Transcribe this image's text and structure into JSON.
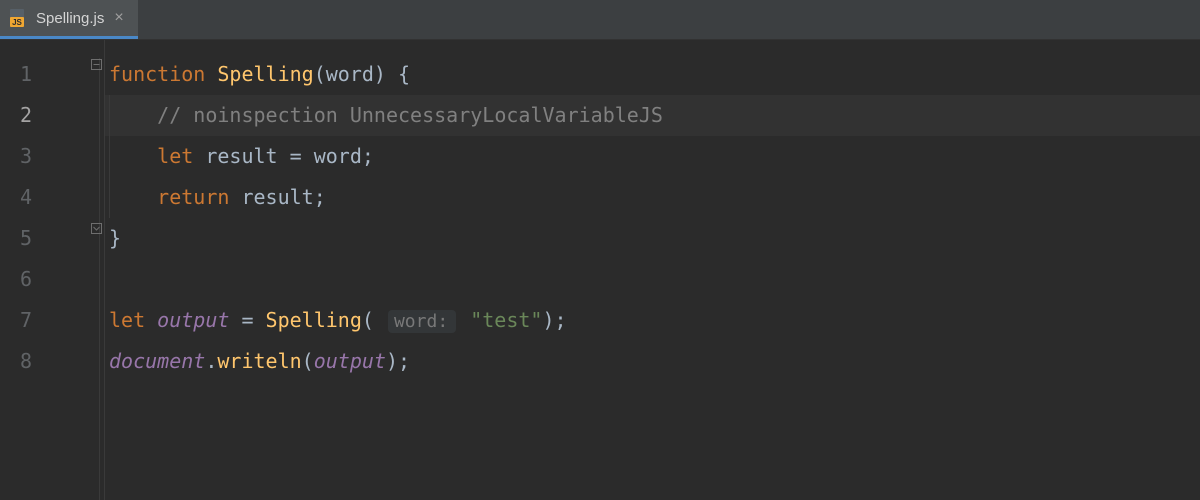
{
  "tab": {
    "filename": "Spelling.js",
    "close": "×"
  },
  "gutter": {
    "lines": [
      "1",
      "2",
      "3",
      "4",
      "5",
      "6",
      "7",
      "8"
    ],
    "currentLine": 2
  },
  "code": {
    "line1": {
      "kw_function": "function",
      "fn_name": "Spelling",
      "open_paren": "(",
      "param": "word",
      "close_paren": ")",
      "brace": " {"
    },
    "line2": {
      "comment": "// noinspection UnnecessaryLocalVariableJS"
    },
    "line3": {
      "kw_let": "let",
      "ident": "result",
      "eq": " = ",
      "rhs": "word",
      "semi": ";"
    },
    "line4": {
      "kw_return": "return",
      "ident": "result",
      "semi": ";"
    },
    "line5": {
      "brace": "}"
    },
    "line7": {
      "kw_let": "let",
      "var": "output",
      "eq": " = ",
      "fn": "Spelling",
      "open": "(",
      "hint": "word:",
      "str": "\"test\"",
      "close": ")",
      "semi": ";"
    },
    "line8": {
      "obj": "document",
      "dot": ".",
      "method": "writeln",
      "open": "(",
      "arg": "output",
      "close": ")",
      "semi": ";"
    }
  }
}
